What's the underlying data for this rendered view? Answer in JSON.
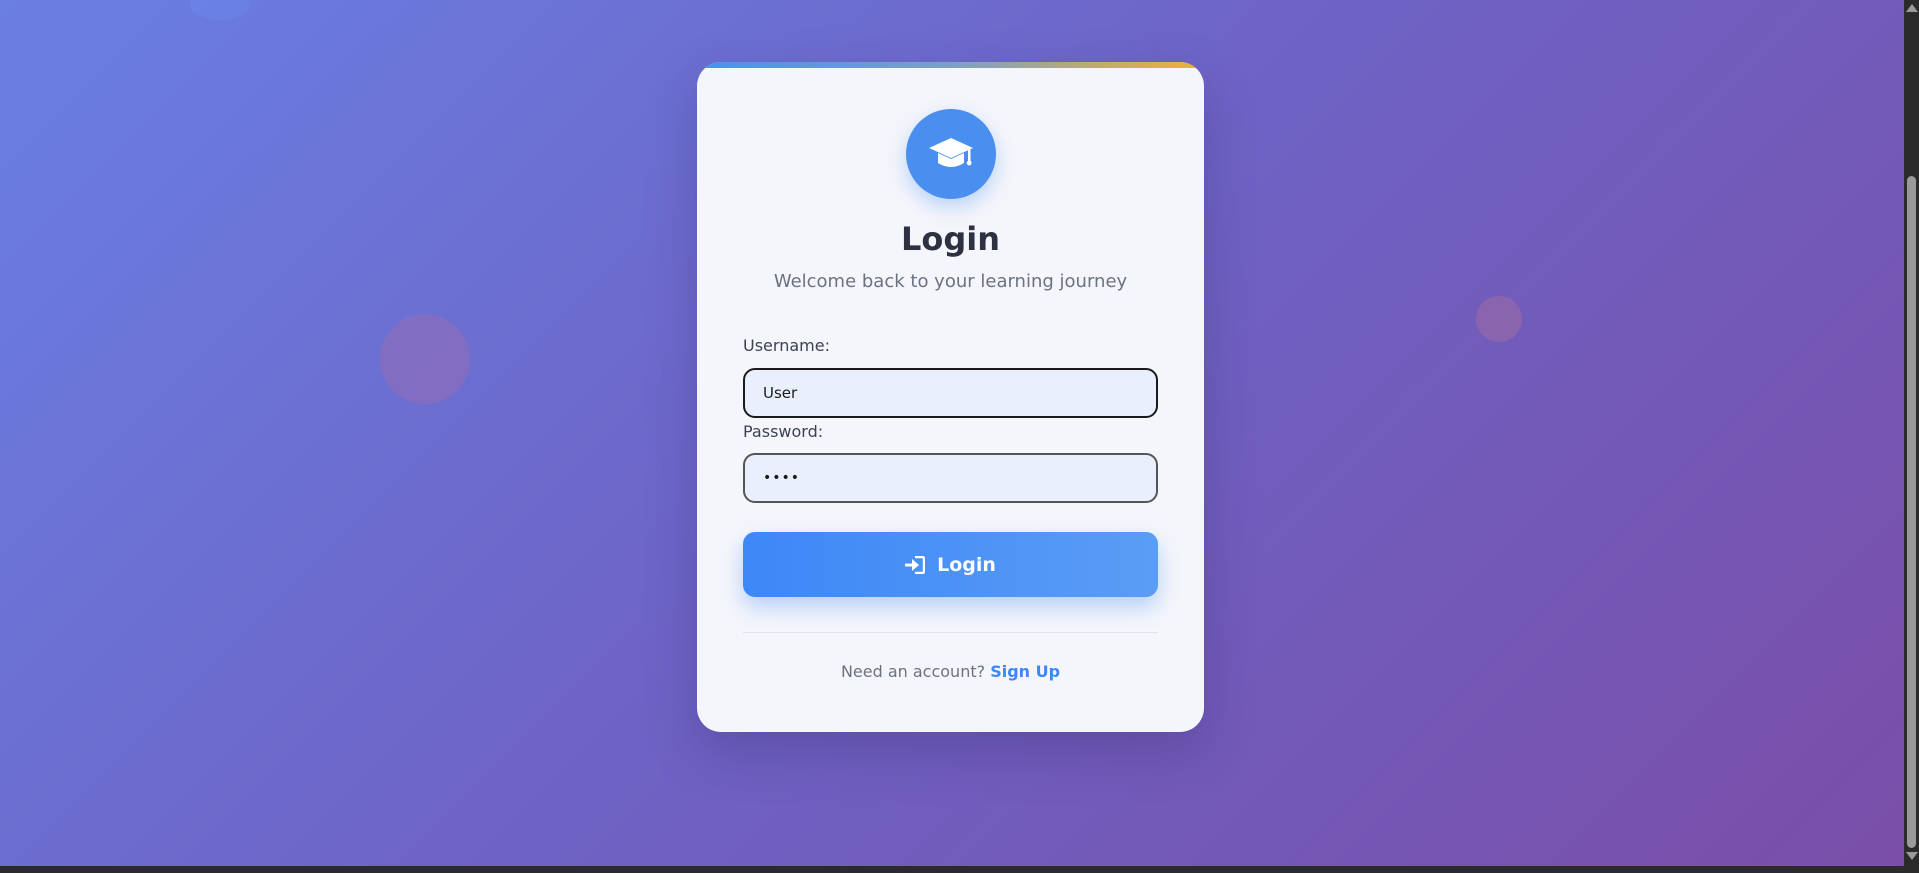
{
  "login_card": {
    "title": "Login",
    "subtitle": "Welcome back to your learning journey",
    "logo_icon": "graduation-cap-icon",
    "username": {
      "label": "Username:",
      "value": "User"
    },
    "password": {
      "label": "Password:",
      "value": "••••"
    },
    "submit": {
      "label": "Login",
      "icon": "sign-in-icon"
    },
    "signup": {
      "prompt": "Need an account?",
      "link_label": "Sign Up"
    }
  },
  "colors": {
    "accent": "#3d87f7",
    "card_background": "#f5f6fb",
    "page_gradient_start": "#6a7fe3",
    "page_gradient_end": "#7a4ea8"
  }
}
